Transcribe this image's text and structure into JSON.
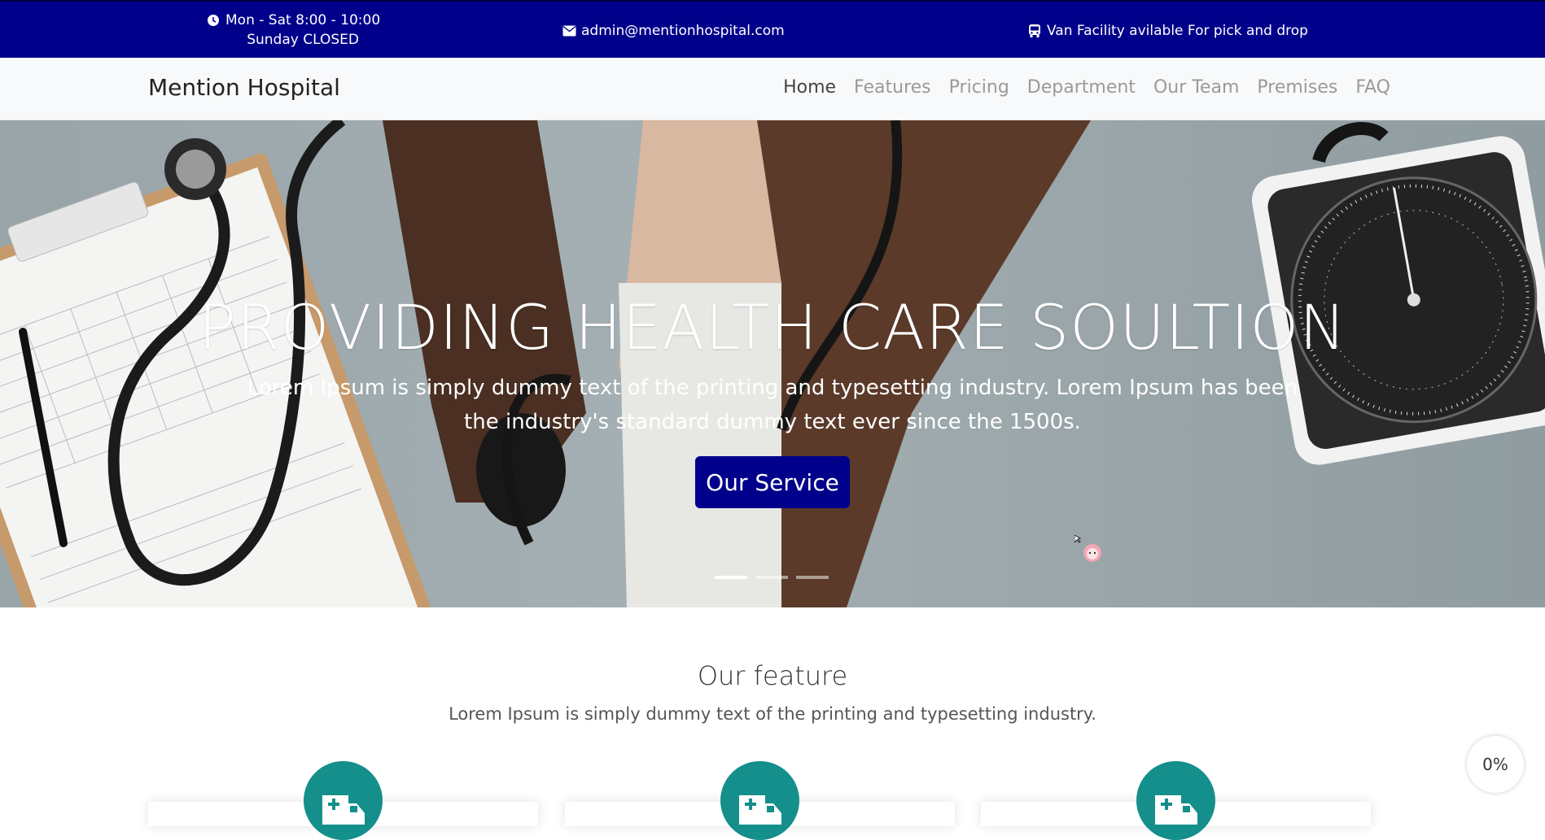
{
  "topbar": {
    "hours_line1": "Mon - Sat 8:00 - 10:00",
    "hours_line2": "Sunday CLOSED",
    "email": "admin@mentionhospital.com",
    "van": "Van Facility avilable For pick and drop",
    "background": "#00008b"
  },
  "navbar": {
    "brand": "Mention Hospital",
    "items": [
      {
        "label": "Home",
        "active": true
      },
      {
        "label": "Features"
      },
      {
        "label": "Pricing"
      },
      {
        "label": "Department"
      },
      {
        "label": "Our Team"
      },
      {
        "label": "Premises"
      },
      {
        "label": "FAQ"
      }
    ]
  },
  "hero": {
    "title": "PROVIDING HEALTH CARE SOULTION",
    "text": "Lorem Ipsum is simply dummy text of the printing and typesetting industry. Lorem Ipsum has been the industry's standard dummy text ever since the 1500s.",
    "button": "Our Service",
    "slides_total": 3,
    "active_slide": 1
  },
  "features": {
    "title": "Our feature",
    "subtitle": "Lorem Ipsum is simply dummy text of the printing and typesetting industry.",
    "icon_color": "#148f8b",
    "icon": "ambulance-icon"
  },
  "scroll_progress": "0%"
}
